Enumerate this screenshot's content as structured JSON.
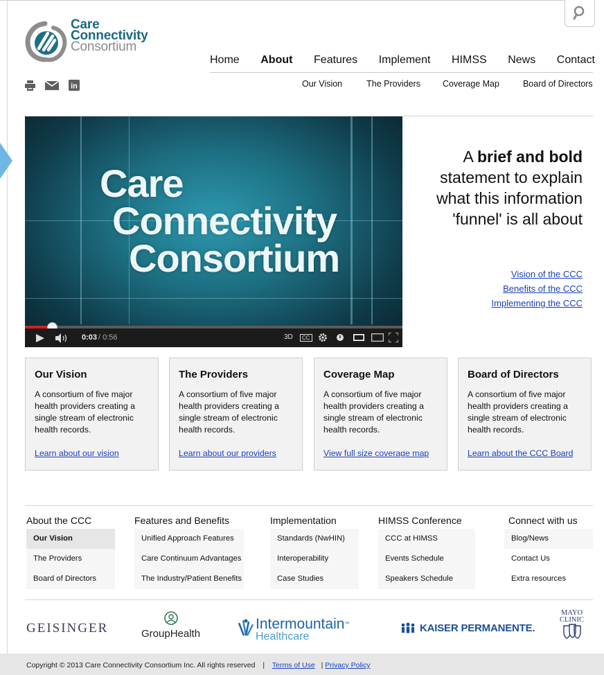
{
  "brand": {
    "line1": "Care",
    "line2": "Connectivity",
    "line3": "Consortium",
    "colors": {
      "teal": "#1a6a82",
      "grey": "#8a8a8a",
      "link": "#1a3fbf"
    }
  },
  "search": {
    "icon": "search-icon"
  },
  "main_nav": [
    "Home",
    "About",
    "Features",
    "Implement",
    "HIMSS",
    "News",
    "Contact"
  ],
  "main_nav_active": "About",
  "tools": {
    "icons": [
      "print-icon",
      "mail-icon",
      "linkedin-icon"
    ],
    "linkedin_text": "in"
  },
  "sub_nav": [
    "Our Vision",
    "The Providers",
    "Coverage Map",
    "Board of Directors"
  ],
  "video": {
    "title_l1": "Care",
    "title_l2": "Connectivity",
    "title_l3": "Consortium",
    "time": "0:03",
    "duration": "/ 0:56",
    "progress_fraction": 0.07,
    "btn_3d": "3D",
    "btn_cc": "CC"
  },
  "hero": {
    "pre": "A ",
    "bold": "brief and bold",
    "rest": " statement to explain what this information 'funnel' is all about",
    "links": [
      "Vision of the CCC",
      "Benefits of the CCC",
      "Implementing the CCC"
    ]
  },
  "cards": [
    {
      "title": "Our Vision",
      "body": "A consortium of five major health providers creating a single stream of electronic health records.",
      "link": "Learn about our vision"
    },
    {
      "title": "The Providers",
      "body": "A consortium of five major health providers creating a single stream of electronic health records.",
      "link": "Learn about our providers"
    },
    {
      "title": "Coverage Map",
      "body": "A consortium of five major health providers creating a single stream of electronic health records.",
      "link": "View full size coverage map"
    },
    {
      "title": "Board of Directors",
      "body": "A consortium of five major health providers creating a single stream of electronic health records.",
      "link": "Learn about the CCC Board"
    }
  ],
  "footer": {
    "cols": [
      {
        "heading": "About the CCC",
        "items": [
          "Our Vision",
          "The Providers",
          "Board of Directors"
        ]
      },
      {
        "heading": "Features and Benefits",
        "items": [
          "Unified Approach Features",
          "Care Continuum Advantages",
          "The Industry/Patient Benefits"
        ]
      },
      {
        "heading": "Implementation",
        "items": [
          "Standards (NwHIN)",
          "Interoperability",
          "Case Studies"
        ]
      },
      {
        "heading": "HIMSS Conference",
        "items": [
          "CCC at HIMSS",
          "Events Schedule",
          "Speakers Schedule"
        ]
      },
      {
        "heading": "Connect with us",
        "items": [
          "Blog/News",
          "Contact Us",
          "Extra resources"
        ]
      }
    ]
  },
  "partners": {
    "geisinger": "GEISINGER",
    "grouphealth": "GroupHealth",
    "intermountain_1": "Intermountain",
    "intermountain_tm": "™",
    "intermountain_2": "Healthcare",
    "kaiser": "KAISER PERMANENTE",
    "kaiser_dot": ".",
    "mayo_1": "MAYO",
    "mayo_2": "CLINIC"
  },
  "copyright": {
    "text": "Copyright © 2013 Care Connectivity Consortium Inc. All rights reserved",
    "sep": "|",
    "terms": "Terms of Use",
    "privacy_sep": "|",
    "privacy": "Privacy Policy"
  }
}
